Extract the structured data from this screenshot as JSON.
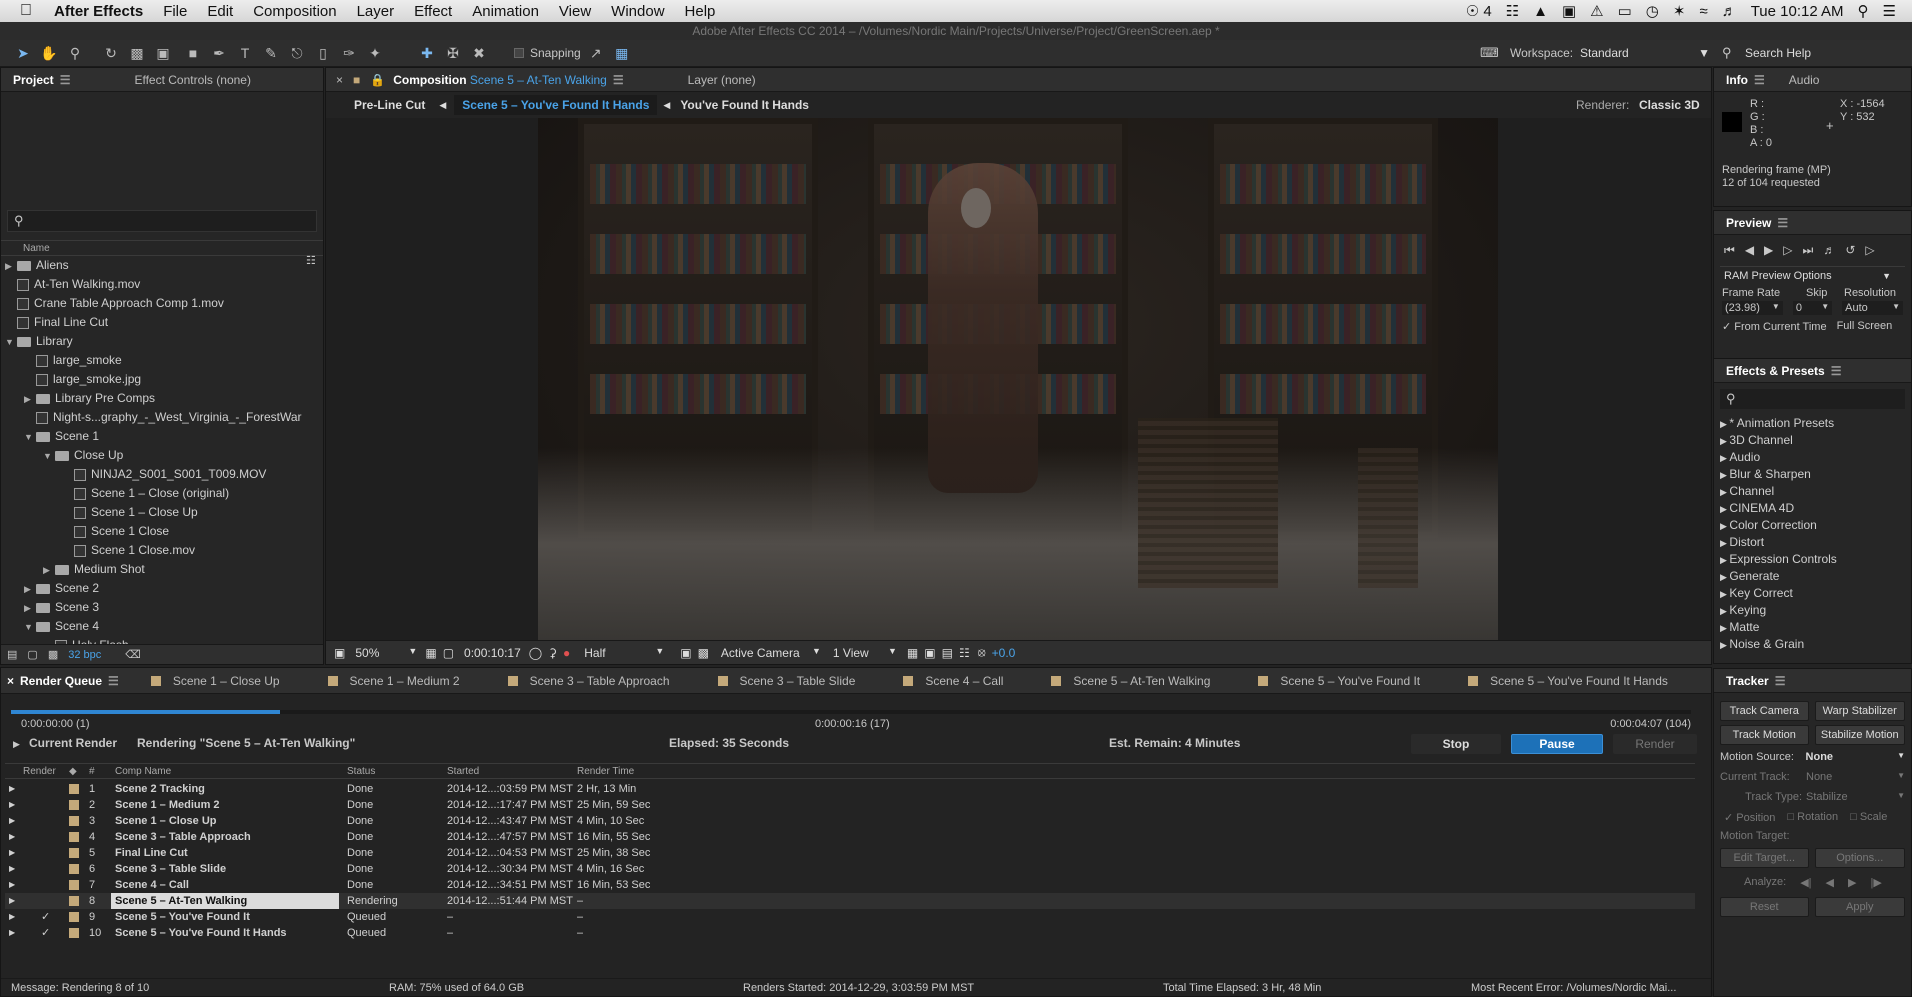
{
  "menubar": {
    "app": "After Effects",
    "items": [
      "File",
      "Edit",
      "Composition",
      "Layer",
      "Effect",
      "Animation",
      "View",
      "Window",
      "Help"
    ],
    "status_count": "4",
    "clock": "Tue 10:12 AM"
  },
  "titlebar": "Adobe After Effects CC 2014 – /Volumes/Nordic Main/Projects/Universe/Project/GreenScreen.aep *",
  "toolbar": {
    "snapping": "Snapping",
    "workspace_label": "Workspace:",
    "workspace": "Standard",
    "search_help": "Search Help"
  },
  "project": {
    "tab": "Project",
    "effect_controls": "Effect Controls (none)",
    "column_name": "Name",
    "bpc": "32 bpc",
    "items": [
      {
        "label": "Aliens",
        "type": "folder",
        "indent": 0,
        "tri": "▶"
      },
      {
        "label": "At-Ten Walking.mov",
        "type": "file",
        "indent": 0,
        "tri": ""
      },
      {
        "label": "Crane Table Approach Comp 1.mov",
        "type": "file",
        "indent": 0,
        "tri": ""
      },
      {
        "label": "Final Line Cut",
        "type": "file",
        "indent": 0,
        "tri": ""
      },
      {
        "label": "Library",
        "type": "folder",
        "indent": 0,
        "tri": "▼"
      },
      {
        "label": "large_smoke",
        "type": "file",
        "indent": 1,
        "tri": ""
      },
      {
        "label": "large_smoke.jpg",
        "type": "file",
        "indent": 1,
        "tri": ""
      },
      {
        "label": "Library Pre Comps",
        "type": "folder",
        "indent": 1,
        "tri": "▶"
      },
      {
        "label": "Night-s...graphy_-_West_Virginia_-_ForestWar",
        "type": "file",
        "indent": 1,
        "tri": ""
      },
      {
        "label": "Scene 1",
        "type": "folder",
        "indent": 1,
        "tri": "▼"
      },
      {
        "label": "Close Up",
        "type": "folder",
        "indent": 2,
        "tri": "▼"
      },
      {
        "label": "NINJA2_S001_S001_T009.MOV",
        "type": "file",
        "indent": 3,
        "tri": ""
      },
      {
        "label": "Scene 1 – Close (original)",
        "type": "file",
        "indent": 3,
        "tri": ""
      },
      {
        "label": "Scene 1 – Close Up",
        "type": "file",
        "indent": 3,
        "tri": ""
      },
      {
        "label": "Scene 1 Close",
        "type": "file",
        "indent": 3,
        "tri": ""
      },
      {
        "label": "Scene 1 Close.mov",
        "type": "file",
        "indent": 3,
        "tri": ""
      },
      {
        "label": "Medium Shot",
        "type": "folder",
        "indent": 2,
        "tri": "▶"
      },
      {
        "label": "Scene 2",
        "type": "folder",
        "indent": 1,
        "tri": "▶"
      },
      {
        "label": "Scene 3",
        "type": "folder",
        "indent": 1,
        "tri": "▶"
      },
      {
        "label": "Scene 4",
        "type": "folder",
        "indent": 1,
        "tri": "▼"
      },
      {
        "label": "Holy Flash",
        "type": "file",
        "indent": 2,
        "tri": ""
      }
    ]
  },
  "composition": {
    "tab_prefix": "Composition",
    "tab_name": "Scene 5 – At-Ten Walking",
    "layer_tab": "Layer (none)",
    "breadcrumbs": [
      "Pre-Line Cut",
      "Scene 5 – You've Found It Hands",
      "You've Found It Hands"
    ],
    "renderer_label": "Renderer:",
    "renderer": "Classic 3D",
    "zoom": "50%",
    "timecode": "0:00:10:17",
    "resolution": "Half",
    "camera": "Active Camera",
    "views": "1 View",
    "exposure": "+0.0"
  },
  "info": {
    "tab": "Info",
    "audio_tab": "Audio",
    "r": "R :",
    "g": "G :",
    "b": "B :",
    "a": "A : 0",
    "x": "X : -1564",
    "y": "Y : 532",
    "status1": "Rendering frame (MP)",
    "status2": "12 of 104 requested"
  },
  "preview": {
    "title": "Preview",
    "ram": "RAM Preview Options",
    "frame_rate_label": "Frame Rate",
    "skip_label": "Skip",
    "resolution_label": "Resolution",
    "frame_rate": "(23.98)",
    "skip": "0",
    "resolution": "Auto",
    "from_current": "From Current Time",
    "full_screen": "Full Screen"
  },
  "effects": {
    "title": "Effects & Presets",
    "items": [
      "* Animation Presets",
      "3D Channel",
      "Audio",
      "Blur & Sharpen",
      "Channel",
      "CINEMA 4D",
      "Color Correction",
      "Distort",
      "Expression Controls",
      "Generate",
      "Key Correct",
      "Keying",
      "Matte",
      "Noise & Grain"
    ]
  },
  "tracker": {
    "title": "Tracker",
    "track_camera": "Track Camera",
    "warp_stabilizer": "Warp Stabilizer",
    "track_motion": "Track Motion",
    "stabilize_motion": "Stabilize Motion",
    "motion_source_label": "Motion Source:",
    "motion_source": "None",
    "current_track_label": "Current Track:",
    "current_track": "None",
    "track_type_label": "Track Type:",
    "track_type": "Stabilize",
    "position": "Position",
    "rotation": "Rotation",
    "scale": "Scale",
    "motion_target": "Motion Target:",
    "edit_target": "Edit Target...",
    "options": "Options...",
    "analyze": "Analyze:",
    "reset": "Reset",
    "apply": "Apply"
  },
  "render": {
    "tabs": [
      "Render Queue",
      "Scene 1 – Close Up",
      "Scene 1 – Medium 2",
      "Scene 3 – Table Approach",
      "Scene 3 – Table Slide",
      "Scene 4 – Call",
      "Scene 5 – At-Ten Walking",
      "Scene 5 – You've Found It",
      "Scene 5 – You've Found It Hands"
    ],
    "progress": 0.16,
    "time_start": "0:00:00:00 (1)",
    "time_mid": "0:00:00:16 (17)",
    "time_end": "0:00:04:07 (104)",
    "current_render": "Current Render",
    "rendering": "Rendering \"Scene 5 – At-Ten Walking\"",
    "elapsed": "Elapsed: 35 Seconds",
    "remain": "Est. Remain: 4 Minutes",
    "stop": "Stop",
    "pause": "Pause",
    "render_btn": "Render",
    "headers": [
      "Render",
      "#",
      "Comp Name",
      "Status",
      "Started",
      "Render Time"
    ],
    "rows": [
      {
        "check": "",
        "num": "1",
        "name": "Scene 2 Tracking",
        "status": "Done",
        "started": "2014-12...:03:59 PM MST",
        "time": "2 Hr, 13 Min"
      },
      {
        "check": "",
        "num": "2",
        "name": "Scene 1 – Medium 2",
        "status": "Done",
        "started": "2014-12...:17:47 PM MST",
        "time": "25 Min, 59 Sec"
      },
      {
        "check": "",
        "num": "3",
        "name": "Scene 1 – Close Up",
        "status": "Done",
        "started": "2014-12...:43:47 PM MST",
        "time": "4 Min, 10 Sec"
      },
      {
        "check": "",
        "num": "4",
        "name": "Scene 3 – Table Approach",
        "status": "Done",
        "started": "2014-12...:47:57 PM MST",
        "time": "16 Min, 55 Sec"
      },
      {
        "check": "",
        "num": "5",
        "name": "Final Line Cut",
        "status": "Done",
        "started": "2014-12...:04:53 PM MST",
        "time": "25 Min, 38 Sec"
      },
      {
        "check": "",
        "num": "6",
        "name": "Scene 3 – Table Slide",
        "status": "Done",
        "started": "2014-12...:30:34 PM MST",
        "time": "4 Min, 16 Sec"
      },
      {
        "check": "",
        "num": "7",
        "name": "Scene 4 – Call",
        "status": "Done",
        "started": "2014-12...:34:51 PM MST",
        "time": "16 Min, 53 Sec"
      },
      {
        "check": "",
        "num": "8",
        "name": "Scene 5 – At-Ten Walking",
        "status": "Rendering",
        "started": "2014-12...:51:44 PM MST",
        "time": "–"
      },
      {
        "check": "✓",
        "num": "9",
        "name": "Scene 5 – You've Found It",
        "status": "Queued",
        "started": "–",
        "time": "–"
      },
      {
        "check": "✓",
        "num": "10",
        "name": "Scene 5 – You've Found It Hands",
        "status": "Queued",
        "started": "–",
        "time": "–"
      }
    ],
    "footer": {
      "message": "Message: Rendering 8 of 10",
      "ram": "RAM: 75% used of 64.0 GB",
      "started": "Renders Started: 2014-12-29, 3:03:59 PM MST",
      "total": "Total Time Elapsed: 3 Hr, 48 Min",
      "error": "Most Recent Error: /Volumes/Nordic Mai..."
    }
  }
}
